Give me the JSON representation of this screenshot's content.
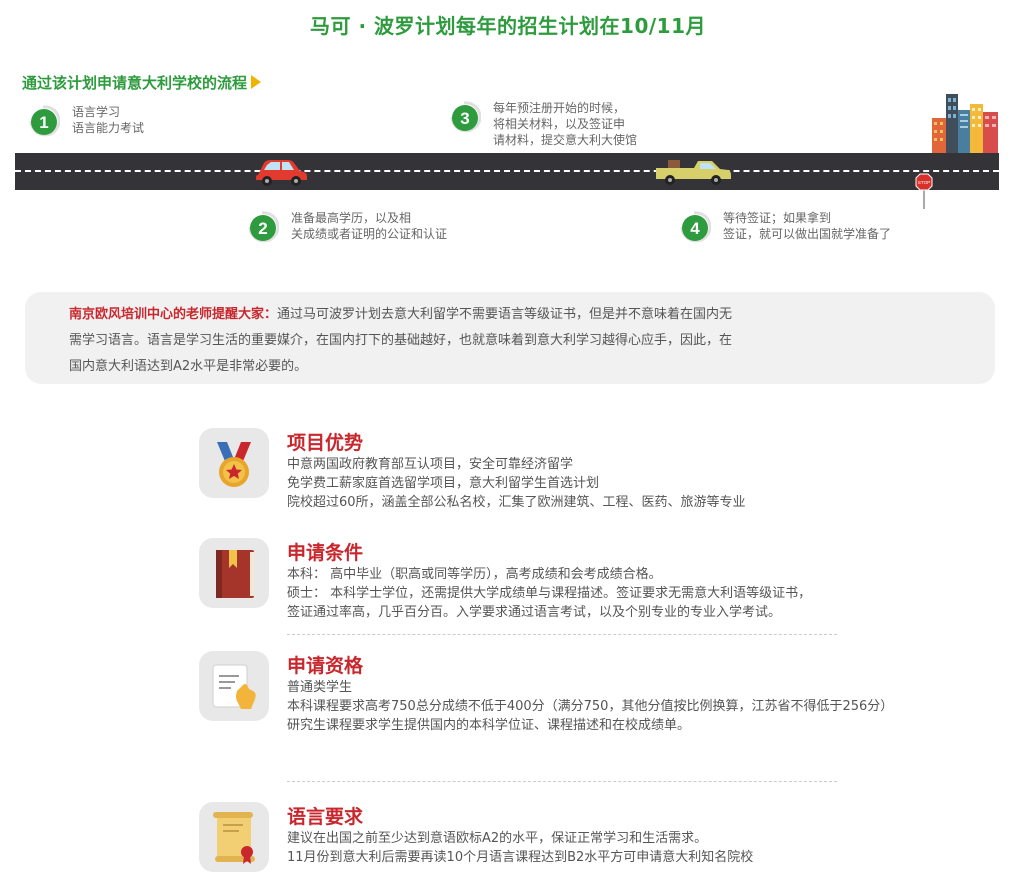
{
  "title": "马可 · 波罗计划每年的招生计划在10/11月",
  "flow": {
    "title": "通过该计划申请意大利学校的流程",
    "steps": [
      {
        "num": "1",
        "lines": [
          "语言学习",
          "语言能力考试"
        ]
      },
      {
        "num": "2",
        "lines": [
          "准备最高学历，以及相",
          "关成绩或者证明的公证和认证"
        ]
      },
      {
        "num": "3",
        "lines": [
          "每年预注册开始的时候，",
          "将相关材料，以及签证申",
          "请材料，提交意大利大使馆"
        ]
      },
      {
        "num": "4",
        "lines": [
          "等待签证；如果拿到",
          "签证，就可以做出国就学准备了"
        ]
      }
    ],
    "stop_sign": "STOP"
  },
  "notice": {
    "highlight": "南京欧风培训中心的老师提醒大家：",
    "lines": [
      "通过马可波罗计划去意大利留学不需要语言等级证书，但是并不意味着在国内无",
      "需学习语言。语言是学习生活的重要媒介，在国内打下的基础越好，也就意味着到意大利学习越得心应手，因此，在",
      "国内意大利语达到A2水平是非常必要的。"
    ]
  },
  "sections": [
    {
      "heading": "项目优势",
      "icon": "medal-icon",
      "lines": [
        "中意两国政府教育部互认项目，安全可靠经济留学",
        "免学费工薪家庭首选留学项目，意大利留学生首选计划",
        "院校超过60所，涵盖全部公私名校，汇集了欧洲建筑、工程、医药、旅游等专业"
      ]
    },
    {
      "heading": "申请条件",
      "icon": "book-icon",
      "lines": [
        "本科：  高中毕业（职高或同等学历），高考成绩和会考成绩合格。",
        "硕士：   本科学士学位，还需提供大学成绩单与课程描述。签证要求无需意大利语等级证书，",
        "签证通过率高，几乎百分百。入学要求通过语言考试，以及个别专业的专业入学考试。"
      ]
    },
    {
      "heading": "申请资格",
      "icon": "document-hand-icon",
      "lines": [
        "普通类学生",
        "本科课程要求高考750总分成绩不低于400分（满分750，其他分值按比例换算，江苏省不得低于256分）",
        "研究生课程要求学生提供国内的本科学位证、课程描述和在校成绩单。"
      ]
    },
    {
      "heading": "语言要求",
      "icon": "certificate-scroll-icon",
      "lines": [
        "建议在出国之前至少达到意语欧标A2的水平，保证正常学习和生活需求。",
        "11月份到意大利后需要再读10个月语言课程达到B2水平方可申请意大利知名院校"
      ]
    }
  ]
}
